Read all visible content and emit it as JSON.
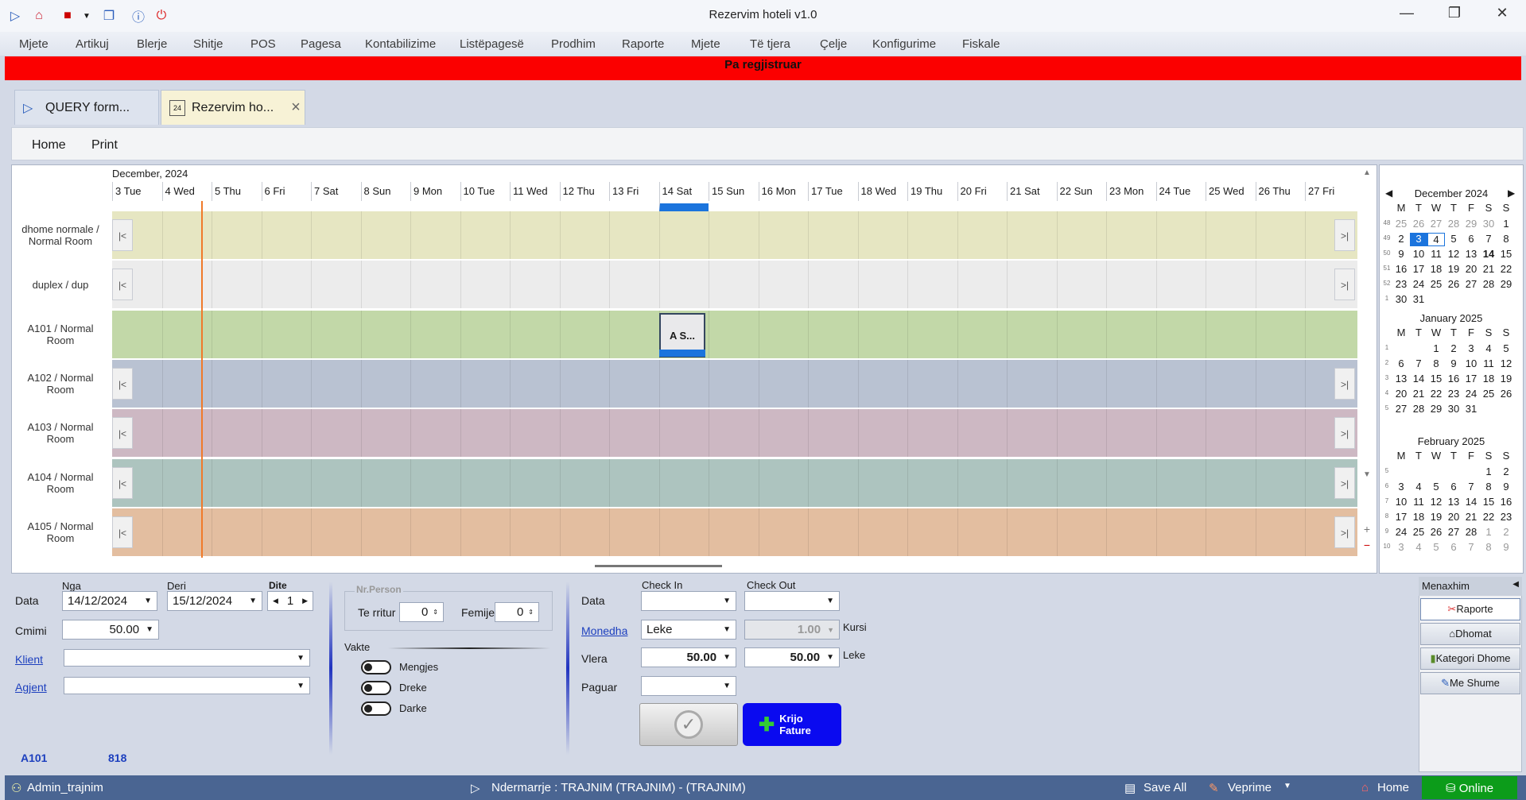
{
  "window": {
    "title": "Rezervim hoteli v1.0",
    "btn_min": "—",
    "btn_max": "❐",
    "btn_close": "✕"
  },
  "menu": [
    "Mjete",
    "Artikuj",
    "Blerje",
    "Shitje",
    "POS",
    "Pagesa",
    "Kontabilizime",
    "Listëpagesë",
    "Prodhim",
    "Raporte",
    "Mjete",
    "Të tjera",
    "Çelje",
    "Konfigurime",
    "Fiskale"
  ],
  "banner": "Pa regjistruar",
  "tabs": [
    {
      "label": "QUERY form..."
    },
    {
      "label": "Rezervim ho...",
      "close": "×"
    }
  ],
  "toolbar": {
    "home": "Home",
    "print": "Print"
  },
  "schedule": {
    "month": "December, 2024",
    "days": [
      "3 Tue",
      "4 Wed",
      "5 Thu",
      "6 Fri",
      "7 Sat",
      "8 Sun",
      "9 Mon",
      "10 Tue",
      "11 Wed",
      "12 Thu",
      "13 Fri",
      "14 Sat",
      "15 Sun",
      "16 Mon",
      "17 Tue",
      "18 Wed",
      "19 Thu",
      "20 Fri",
      "21 Sat",
      "22 Sun",
      "23 Mon",
      "24 Tue",
      "25 Wed",
      "26 Thu",
      "27 Fri"
    ],
    "rooms": [
      {
        "label": "dhome normale / Normal Room",
        "color": "#e6e6c2"
      },
      {
        "label": "duplex / dup",
        "color": "#ececec"
      },
      {
        "label": "A101 / Normal Room",
        "color": "#c2d8a8"
      },
      {
        "label": "A102 / Normal Room",
        "color": "#b9c2d2"
      },
      {
        "label": "A103 / Normal Room",
        "color": "#cdb8c3"
      },
      {
        "label": "A104 / Normal Room",
        "color": "#adc4bf"
      },
      {
        "label": "A105 / Normal Room",
        "color": "#e3bea0"
      }
    ],
    "appointment": "A S...",
    "prev_icon": "|<",
    "next_icon": ">|"
  },
  "calendar": {
    "months": [
      {
        "title": "December 2024",
        "weeks": [
          [
            "48",
            "25",
            "26",
            "27",
            "28",
            "29",
            "30",
            "1"
          ],
          [
            "49",
            "2",
            "3",
            "4",
            "5",
            "6",
            "7",
            "8"
          ],
          [
            "50",
            "9",
            "10",
            "11",
            "12",
            "13",
            "14",
            "15"
          ],
          [
            "51",
            "16",
            "17",
            "18",
            "19",
            "20",
            "21",
            "22"
          ],
          [
            "52",
            "23",
            "24",
            "25",
            "26",
            "27",
            "28",
            "29"
          ],
          [
            "1",
            "30",
            "31",
            "",
            "",
            "",
            "",
            ""
          ]
        ]
      },
      {
        "title": "January 2025",
        "weeks": [
          [
            "1",
            "",
            "",
            "1",
            "2",
            "3",
            "4",
            "5"
          ],
          [
            "2",
            "6",
            "7",
            "8",
            "9",
            "10",
            "11",
            "12"
          ],
          [
            "3",
            "13",
            "14",
            "15",
            "16",
            "17",
            "18",
            "19"
          ],
          [
            "4",
            "20",
            "21",
            "22",
            "23",
            "24",
            "25",
            "26"
          ],
          [
            "5",
            "27",
            "28",
            "29",
            "30",
            "31",
            "",
            ""
          ]
        ]
      },
      {
        "title": "February 2025",
        "weeks": [
          [
            "5",
            "",
            "",
            "",
            "",
            "",
            "1",
            "2"
          ],
          [
            "6",
            "3",
            "4",
            "5",
            "6",
            "7",
            "8",
            "9"
          ],
          [
            "7",
            "10",
            "11",
            "12",
            "13",
            "14",
            "15",
            "16"
          ],
          [
            "8",
            "17",
            "18",
            "19",
            "20",
            "21",
            "22",
            "23"
          ],
          [
            "9",
            "24",
            "25",
            "26",
            "27",
            "28",
            "1",
            "2"
          ],
          [
            "10",
            "3",
            "4",
            "5",
            "6",
            "7",
            "8",
            "9"
          ]
        ]
      }
    ],
    "dow": [
      "M",
      "T",
      "W",
      "T",
      "F",
      "S",
      "S"
    ]
  },
  "form": {
    "nga": "Nga",
    "deri": "Deri",
    "dite": "Dite",
    "data": "Data",
    "data_from": "14/12/2024",
    "data_to": "15/12/2024",
    "dite_val": "1",
    "cmimi": "Cmimi",
    "cmimi_val": "50.00",
    "klient": "Klient",
    "agjent": "Agjent",
    "nrperson": "Nr.Person",
    "te_rritur": "Te rritur",
    "te_rritur_val": "0",
    "femije": "Femije",
    "femije_val": "0",
    "vakte": "Vakte",
    "mengjes": "Mengjes",
    "dreke": "Dreke",
    "darke": "Darke",
    "data2": "Data",
    "checkin": "Check In",
    "checkout": "Check Out",
    "monedha": "Monedha",
    "monedha_val": "Leke",
    "kurs_val": "1.00",
    "kursi": "Kursi",
    "vlera": "Vlera",
    "vlera_val": "50.00",
    "vlera2_val": "50.00",
    "leke": "Leke",
    "paguar": "Paguar",
    "krijo": "Krijo Fature",
    "room": "A101",
    "num": "818"
  },
  "side": {
    "title": "Menaxhim",
    "buttons": [
      "Raporte",
      "Dhomat",
      "Kategori Dhome",
      "Me Shume"
    ]
  },
  "status": {
    "user": "Admin_trajnim",
    "company": "Ndermarrje : TRAJNIM (TRAJNIM) - (TRAJNIM)",
    "save": "Save All",
    "ops": "Veprime",
    "home": "Home",
    "online": "Online"
  }
}
